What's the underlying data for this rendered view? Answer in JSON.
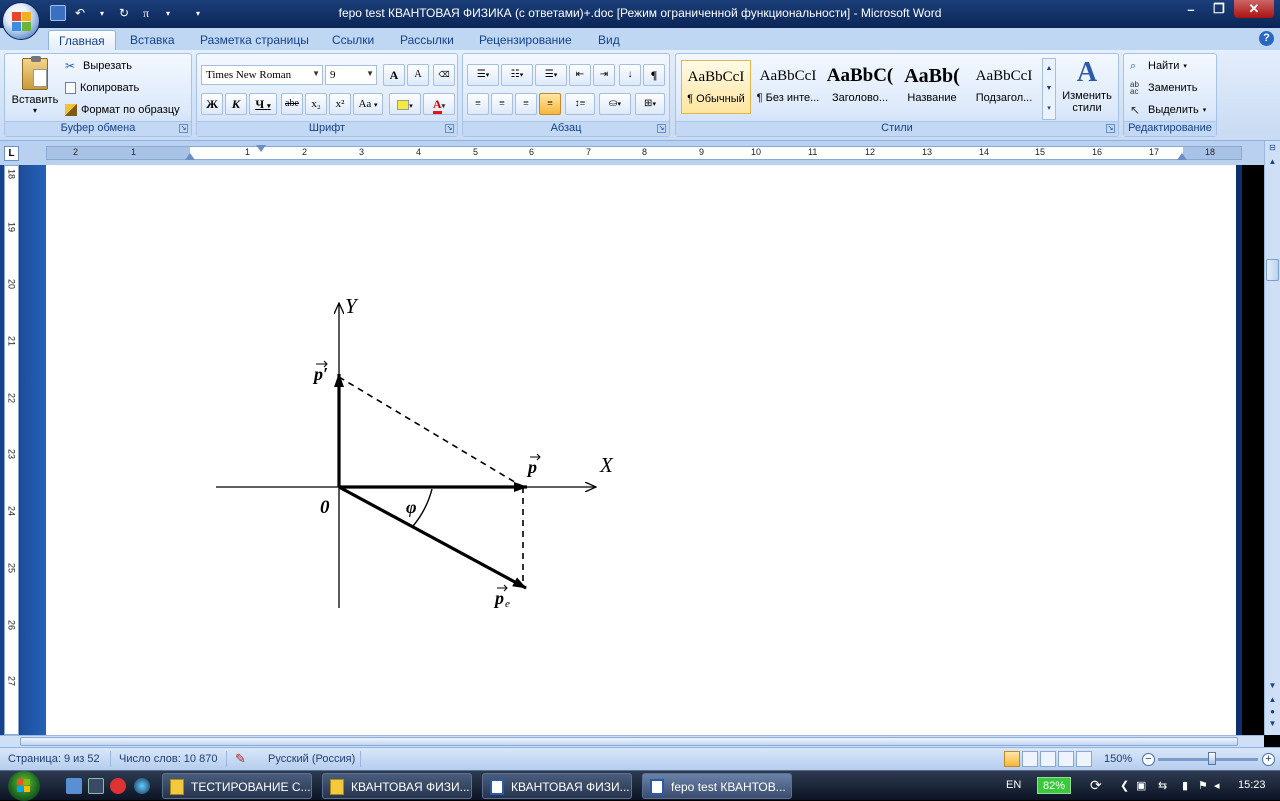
{
  "window": {
    "title": "fepo test КВАНТОВАЯ ФИЗИКА (с ответами)+.doc [Режим ограниченной функциональности] - Microsoft Word"
  },
  "tabs": [
    {
      "label": "Главная",
      "active": true
    },
    {
      "label": "Вставка"
    },
    {
      "label": "Разметка страницы"
    },
    {
      "label": "Ссылки"
    },
    {
      "label": "Рассылки"
    },
    {
      "label": "Рецензирование"
    },
    {
      "label": "Вид"
    }
  ],
  "ribbon": {
    "clipboard": {
      "label": "Буфер обмена",
      "paste": "Вставить",
      "cut": "Вырезать",
      "copy": "Копировать",
      "format_painter": "Формат по образцу"
    },
    "font": {
      "label": "Шрифт",
      "font_name": "Times New Roman",
      "font_size": "9",
      "bold": "Ж",
      "italic": "К",
      "underline": "Ч",
      "strikethrough": "abe",
      "subscript": "x₂",
      "superscript": "x²",
      "change_case": "Aa",
      "grow": "A",
      "shrink": "A"
    },
    "paragraph": {
      "label": "Абзац",
      "show_marks": "¶"
    },
    "styles": {
      "label": "Стили",
      "items": [
        {
          "sample": "AaBbCcI",
          "name": "¶ Обычный",
          "active": true
        },
        {
          "sample": "AaBbCcI",
          "name": "¶ Без инте..."
        },
        {
          "sample": "AaBbC(",
          "name": "Заголово..."
        },
        {
          "sample": "AaBb(",
          "name": "Название"
        },
        {
          "sample": "AaBbCcI",
          "name": "Подзагол..."
        }
      ],
      "change_styles": "Изменить стили"
    },
    "editing": {
      "label": "Редактирование",
      "find": "Найти",
      "replace": "Заменить",
      "select": "Выделить"
    }
  },
  "ruler": {
    "h_numbers": [
      "2",
      "1",
      "1",
      "2",
      "3",
      "4",
      "5",
      "6",
      "7",
      "8",
      "9",
      "10",
      "11",
      "12",
      "13",
      "14",
      "15",
      "16",
      "17",
      "18"
    ],
    "v_numbers": [
      "18",
      "19",
      "20",
      "21",
      "22",
      "23",
      "24",
      "25",
      "26",
      "27"
    ]
  },
  "diagram": {
    "y_axis": "Y",
    "x_axis": "X",
    "origin": "0",
    "angle": "φ",
    "p_prime": "p′",
    "p": "p",
    "p_e": "p",
    "p_e_sub": "e"
  },
  "status": {
    "page": "Страница: 9 из 52",
    "words": "Число слов: 10 870",
    "language": "Русский (Россия)",
    "zoom": "150%"
  },
  "taskbar": {
    "tasks": [
      {
        "label": "ТЕСТИРОВАНИЕ С..."
      },
      {
        "label": "КВАНТОВАЯ ФИЗИ..."
      },
      {
        "label": "КВАНТОВАЯ ФИЗИ..."
      },
      {
        "label": "fepo test КВАНТОВ..."
      }
    ],
    "lang": "EN",
    "battery": "82%",
    "time": "15:23"
  }
}
